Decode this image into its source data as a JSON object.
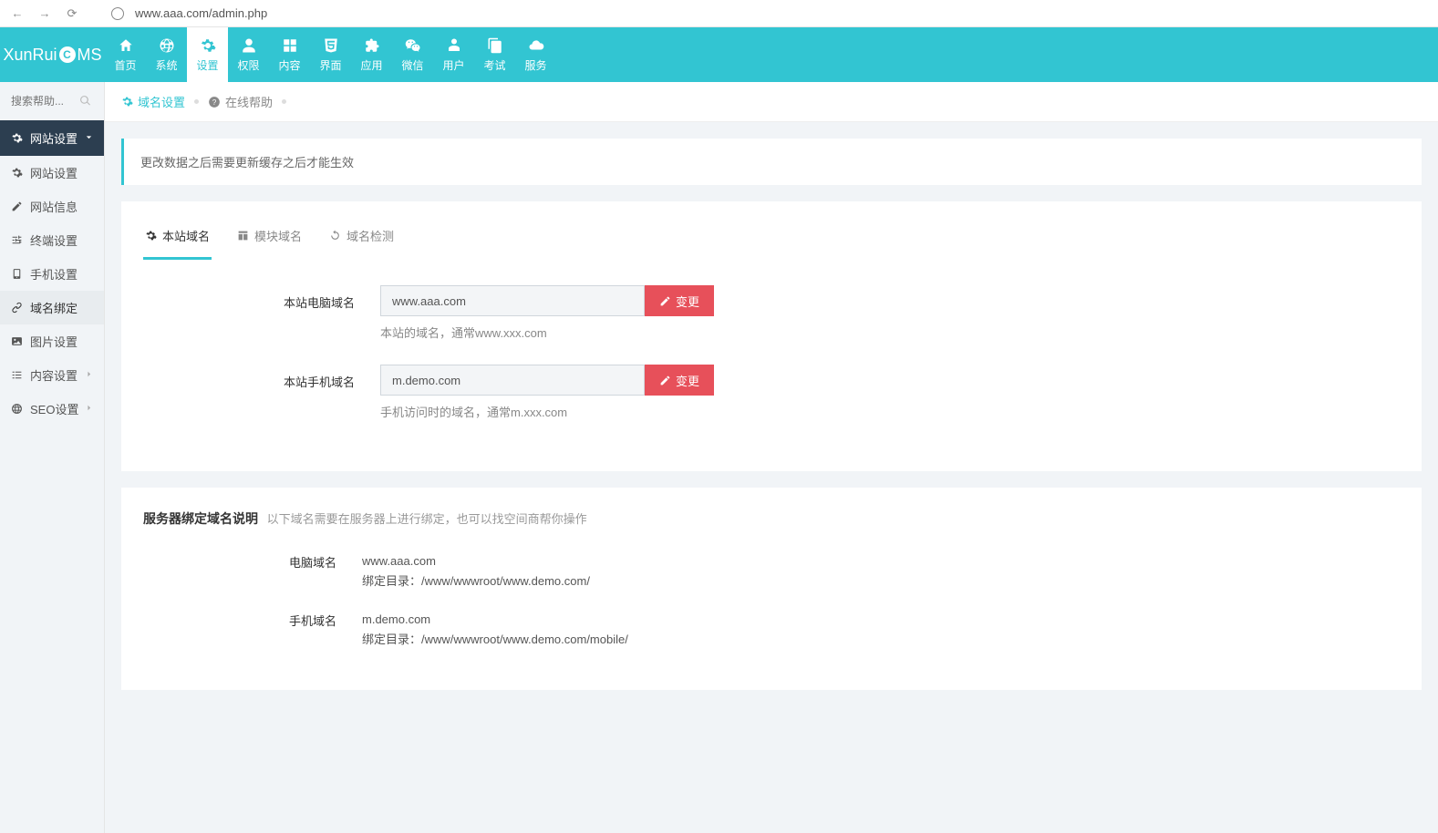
{
  "browser": {
    "url": "www.aaa.com/admin.php"
  },
  "logo": {
    "name": "XunRuiCMS",
    "prefix": "XunRui",
    "suffix": "MS"
  },
  "topnav": [
    {
      "label": "首页",
      "icon": "home"
    },
    {
      "label": "系统",
      "icon": "globe"
    },
    {
      "label": "设置",
      "icon": "cog",
      "active": true
    },
    {
      "label": "权限",
      "icon": "user"
    },
    {
      "label": "内容",
      "icon": "grid"
    },
    {
      "label": "界面",
      "icon": "html5"
    },
    {
      "label": "应用",
      "icon": "puzzle"
    },
    {
      "label": "微信",
      "icon": "wechat"
    },
    {
      "label": "用户",
      "icon": "person"
    },
    {
      "label": "考试",
      "icon": "copy"
    },
    {
      "label": "服务",
      "icon": "cloud"
    }
  ],
  "sidebar": {
    "search_placeholder": "搜索帮助...",
    "group": "网站设置",
    "items": [
      {
        "label": "网站设置",
        "icon": "cog"
      },
      {
        "label": "网站信息",
        "icon": "edit"
      },
      {
        "label": "终端设置",
        "icon": "sliders"
      },
      {
        "label": "手机设置",
        "icon": "mobile"
      },
      {
        "label": "域名绑定",
        "icon": "link",
        "active": true
      },
      {
        "label": "图片设置",
        "icon": "image"
      },
      {
        "label": "内容设置",
        "icon": "list",
        "expandable": true
      },
      {
        "label": "SEO设置",
        "icon": "globe2",
        "expandable": true
      }
    ]
  },
  "breadcrumb": {
    "item1": "域名设置",
    "item2": "在线帮助"
  },
  "alert": "更改数据之后需要更新缓存之后才能生效",
  "tabs": [
    {
      "label": "本站域名",
      "icon": "cog",
      "active": true
    },
    {
      "label": "模块域名",
      "icon": "table"
    },
    {
      "label": "域名检测",
      "icon": "refresh"
    }
  ],
  "form": {
    "row1": {
      "label": "本站电脑域名",
      "value": "www.aaa.com",
      "help": "本站的域名，通常www.xxx.com"
    },
    "row2": {
      "label": "本站手机域名",
      "value": "m.demo.com",
      "help": "手机访问时的域名，通常m.xxx.com"
    },
    "change_btn": "变更"
  },
  "serverinfo": {
    "title": "服务器绑定域名说明",
    "sub": "以下域名需要在服务器上进行绑定，也可以找空间商帮你操作",
    "rows": [
      {
        "label": "电脑域名",
        "domain": "www.aaa.com",
        "path_label": "绑定目录：",
        "path": "/www/wwwroot/www.demo.com/"
      },
      {
        "label": "手机域名",
        "domain": "m.demo.com",
        "path_label": "绑定目录：",
        "path": "/www/wwwroot/www.demo.com/mobile/"
      }
    ]
  }
}
